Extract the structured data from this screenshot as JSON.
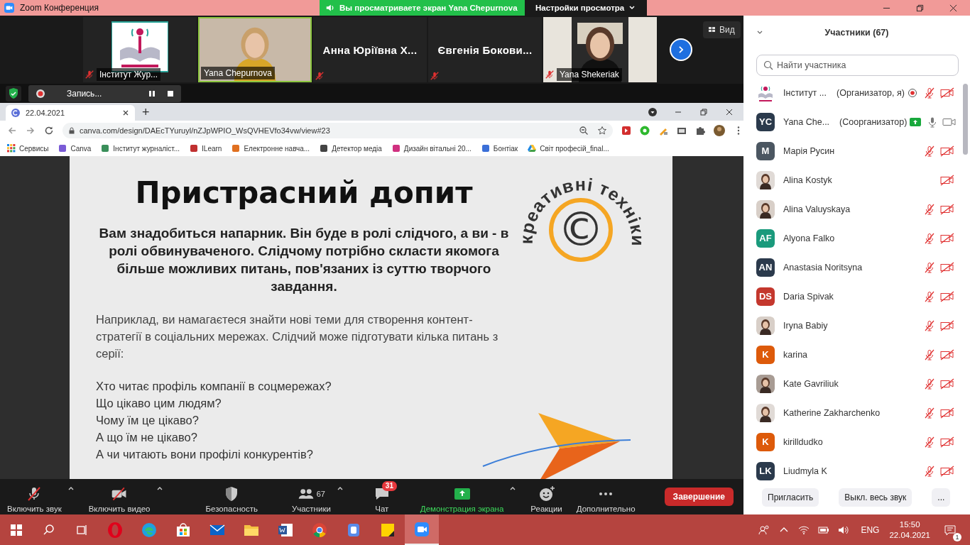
{
  "title_bar": {
    "title": "Zoom Конференция",
    "banner": "Вы просматриваете экран Yana Chepurnova",
    "view_options": "Настройки просмотра"
  },
  "video_strip": {
    "tiles": [
      {
        "kind": "logo",
        "name": "Інститут Жур...",
        "muted": true,
        "active": false
      },
      {
        "kind": "video",
        "name": "Yana Chepurnova",
        "muted": false,
        "active": true
      },
      {
        "kind": "name",
        "name": "Анна Юріївна Х...",
        "muted": true,
        "active": false
      },
      {
        "kind": "name",
        "name": "Євгенія Бокови...",
        "muted": true,
        "active": false
      },
      {
        "kind": "video",
        "name": "Yana Shekeriak",
        "muted": true,
        "active": false
      }
    ],
    "view_button": "Вид"
  },
  "recording": {
    "label": "Запись..."
  },
  "browser": {
    "tabs": [
      {
        "title": "22.04.2021",
        "selected": true
      }
    ],
    "new_tab": "+",
    "url": "canva.com/design/DAEcTYuruyl/nZJpWPIO_WsQVHEVfo34vw/view#23",
    "bookmarks": [
      {
        "label": "Сервисы",
        "kind": "apps"
      },
      {
        "label": "Canva",
        "kind": "site"
      },
      {
        "label": "Інститут журналіст...",
        "kind": "site"
      },
      {
        "label": "ILearn",
        "kind": "site"
      },
      {
        "label": "Електронне навча...",
        "kind": "site"
      },
      {
        "label": "Детектор медіа",
        "kind": "site"
      },
      {
        "label": "Дизайн вітальні 20...",
        "kind": "site"
      },
      {
        "label": "Бонтіак",
        "kind": "site"
      },
      {
        "label": "Світ професій_final...",
        "kind": "drive"
      }
    ]
  },
  "slide": {
    "title": "Пристрасний допит",
    "lead": "Вам знадобиться напарник. Він буде в ролі слідчого, а ви - в ролі обвинуваченого. Слідчому потрібно скласти якомога більше можливих питань, пов'язаних із суттю творчого завдання.",
    "paragraph": "Наприклад, ви намагаєтеся знайти нові теми для створення контент-стратегії в соціальних мережах. Слідчий може підготувати кілька питань з серії:",
    "questions": [
      "Хто читає профіль компанії в соцмережах?",
      "Що цікаво цим людям?",
      "Чому їм це цікаво?",
      "А що їм не цікаво?",
      "А чи читають вони профілі конкурентів?"
    ],
    "stamp_text": "креативні техніки",
    "stamp_symbol": "©"
  },
  "toolbar": {
    "items": [
      {
        "kind": "mic",
        "label": "Включить звук",
        "off": true
      },
      {
        "kind": "video",
        "label": "Включить видео",
        "off": true
      },
      {
        "kind": "security",
        "label": "Безопасность"
      },
      {
        "kind": "participants",
        "label": "Участники",
        "count": "67"
      },
      {
        "kind": "chat",
        "label": "Чат",
        "badge": "31"
      },
      {
        "kind": "share",
        "label": "Демонстрация экрана"
      },
      {
        "kind": "reactions",
        "label": "Реакции"
      },
      {
        "kind": "more",
        "label": "Дополнительно"
      }
    ],
    "end_button": "Завершение"
  },
  "participants": {
    "title": "Участники (67)",
    "search": {
      "placeholder": "Найти участника"
    },
    "items": [
      {
        "name": "Інститут ...",
        "role": "(Организатор, я)",
        "avatar": {
          "kind": "logo"
        },
        "audio": true,
        "mic_muted": true,
        "video_on": false,
        "recording": true,
        "sharing": false
      },
      {
        "name": "Yana Che...",
        "role": "(Соорганизатор)",
        "avatar": {
          "kind": "initials",
          "initials": "YC",
          "color": "#2b3a4c"
        },
        "audio": true,
        "mic_muted": false,
        "video_on": true,
        "recording": false,
        "sharing": true
      },
      {
        "name": "Марія Русин",
        "avatar": {
          "kind": "initials",
          "initials": "M",
          "color": "#4b5661"
        },
        "audio": true,
        "mic_muted": true,
        "video_on": false,
        "recording": false,
        "sharing": false
      },
      {
        "name": "Alina Kostyk",
        "audio": false,
        "video_on": false,
        "recording": false,
        "sharing": false
      },
      {
        "name": "Alina Valuyskaya",
        "audio": true,
        "mic_muted": true,
        "video_on": false,
        "recording": false,
        "sharing": false
      },
      {
        "name": "Alyona Falko",
        "avatar": {
          "kind": "initials",
          "initials": "AF",
          "color": "#1a9a7c"
        },
        "audio": true,
        "mic_muted": true,
        "video_on": false,
        "recording": false,
        "sharing": false
      },
      {
        "name": "Anastasia Noritsyna",
        "avatar": {
          "kind": "initials",
          "initials": "AN",
          "color": "#2b3a4c"
        },
        "audio": true,
        "mic_muted": true,
        "video_on": false,
        "recording": false,
        "sharing": false
      },
      {
        "name": "Daria Spivak",
        "avatar": {
          "kind": "initials",
          "initials": "DS",
          "color": "#c4372d"
        },
        "audio": true,
        "mic_muted": true,
        "video_on": false,
        "recording": false,
        "sharing": false
      },
      {
        "name": "Iryna Babiy",
        "audio": true,
        "mic_muted": true,
        "video_on": false,
        "recording": false,
        "sharing": false
      },
      {
        "name": "karina",
        "avatar": {
          "kind": "initials",
          "initials": "K",
          "color": "#dd5a0a"
        },
        "audio": true,
        "mic_muted": true,
        "video_on": false,
        "recording": false,
        "sharing": false
      },
      {
        "name": "Kate Gavriliuk",
        "audio": true,
        "mic_muted": true,
        "video_on": false,
        "recording": false,
        "sharing": false
      },
      {
        "name": "Katherine Zakharchenko",
        "audio": true,
        "mic_muted": true,
        "video_on": false,
        "recording": false,
        "sharing": false
      },
      {
        "name": "kirilldudko",
        "avatar": {
          "kind": "initials",
          "initials": "K",
          "color": "#dd5a0a"
        },
        "audio": true,
        "mic_muted": true,
        "video_on": false,
        "recording": false,
        "sharing": false
      },
      {
        "name": "Liudmyla K",
        "avatar": {
          "kind": "initials",
          "initials": "LK",
          "color": "#2b3a4c"
        },
        "audio": true,
        "mic_muted": true,
        "video_on": false,
        "recording": false,
        "sharing": false
      }
    ],
    "buttons": [
      "Пригласить",
      "Выкл. весь звук",
      "..."
    ]
  },
  "taskbar": {
    "apps": [
      {
        "kind": "opera",
        "running": false
      },
      {
        "kind": "edge",
        "running": false
      },
      {
        "kind": "store",
        "running": false
      },
      {
        "kind": "mail",
        "running": false
      },
      {
        "kind": "files",
        "running": false
      },
      {
        "kind": "word",
        "running": false
      },
      {
        "kind": "chrome",
        "running": false
      },
      {
        "kind": "app",
        "running": false
      },
      {
        "kind": "notes",
        "running": false
      },
      {
        "kind": "zoom",
        "running": true
      }
    ],
    "language": "ENG",
    "time": "15:50",
    "date": "22.04.2021",
    "notifications": "1"
  }
}
